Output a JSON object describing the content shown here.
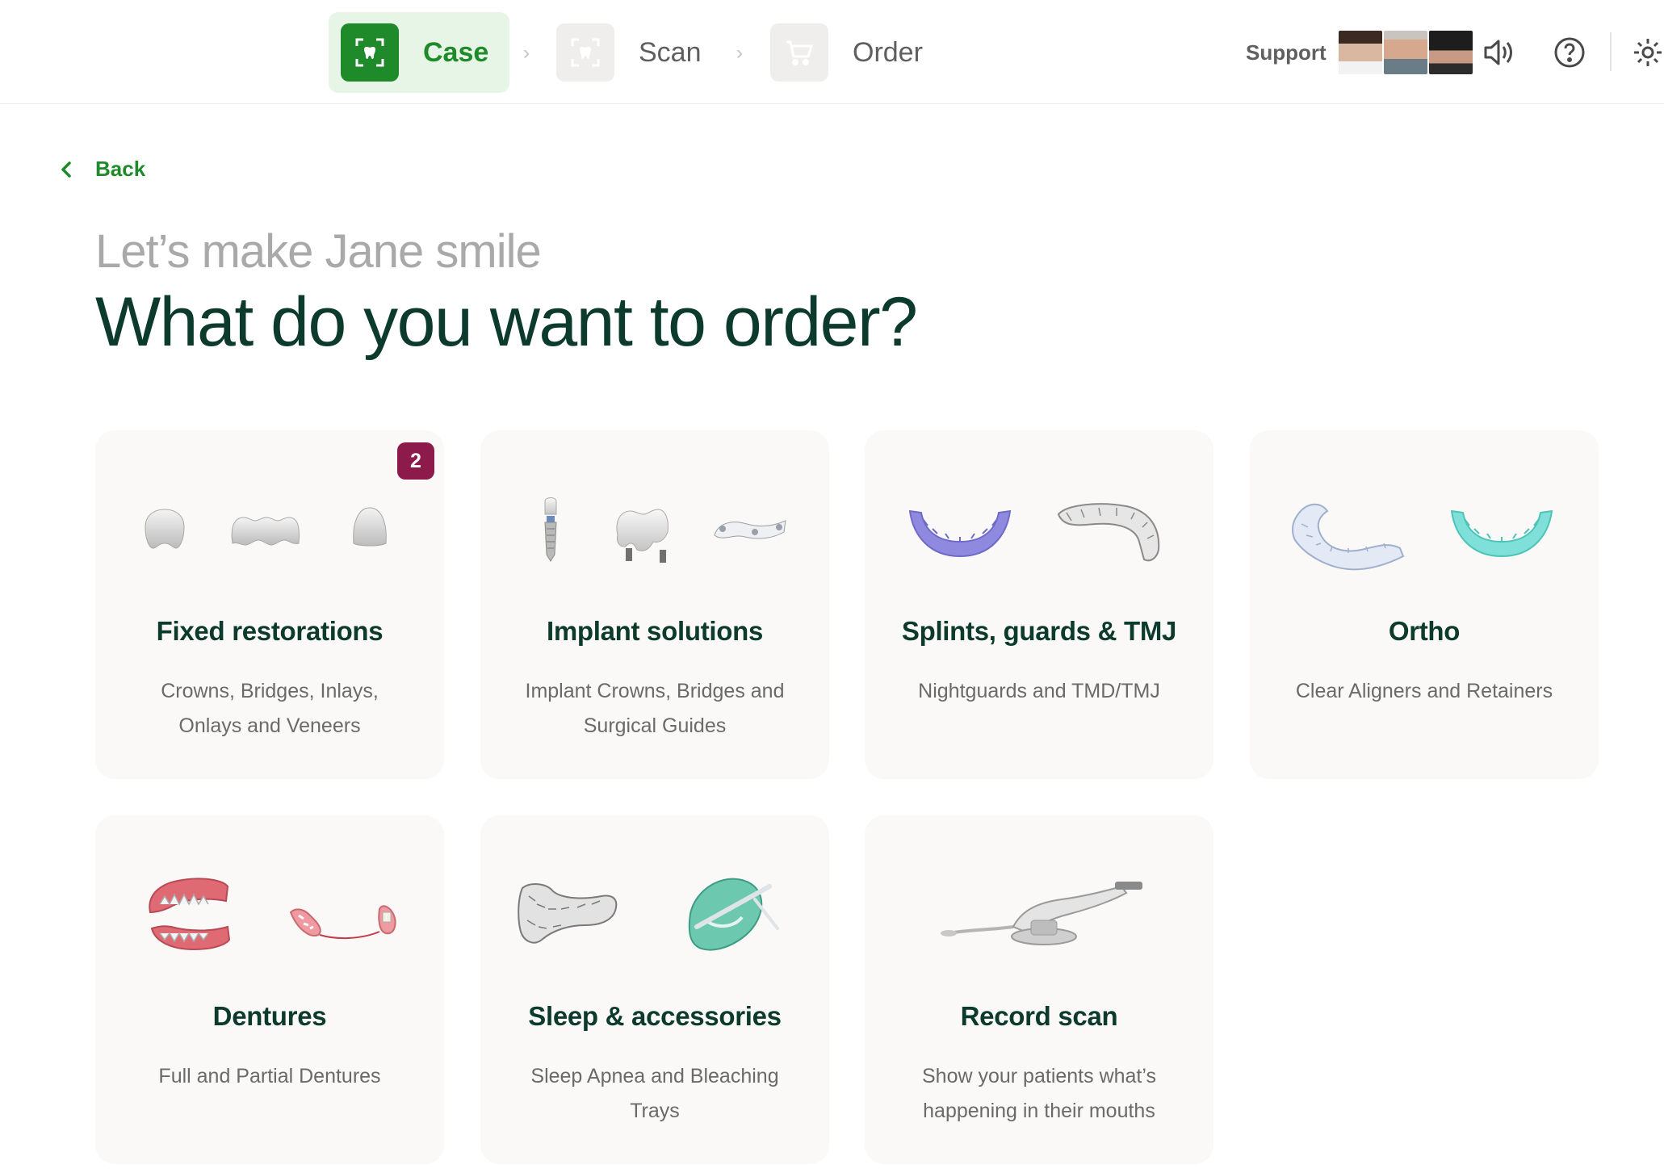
{
  "steps": [
    {
      "label": "Case",
      "icon": "tooth-scan-icon",
      "state": "active"
    },
    {
      "label": "Scan",
      "icon": "scan-frame-icon",
      "state": "inactive"
    },
    {
      "label": "Order",
      "icon": "cart-icon",
      "state": "inactive"
    }
  ],
  "header": {
    "support_label": "Support",
    "icons": [
      "volume-icon",
      "help-icon",
      "settings-icon"
    ]
  },
  "back_label": "Back",
  "subtitle": "Let’s make Jane smile",
  "title": "What do you want to order?",
  "cards": [
    {
      "name": "Fixed restorations",
      "desc": "Crowns, Bridges, Inlays, Onlays and Veneers",
      "badge": "2"
    },
    {
      "name": "Implant solutions",
      "desc": "Implant Crowns, Bridges and Surgical Guides"
    },
    {
      "name": "Splints, guards & TMJ",
      "desc": "Nightguards and TMD/TMJ"
    },
    {
      "name": "Ortho",
      "desc": "Clear Aligners and Retainers"
    },
    {
      "name": "Dentures",
      "desc": "Full and Partial Dentures"
    },
    {
      "name": "Sleep & accessories",
      "desc": "Sleep Apnea and Bleaching Trays"
    },
    {
      "name": "Record scan",
      "desc": "Show your patients what’s happening in their mouths"
    }
  ],
  "colors": {
    "accent": "#1f8a2a",
    "badge": "#8c1a4a",
    "heading": "#0c3a2c"
  }
}
